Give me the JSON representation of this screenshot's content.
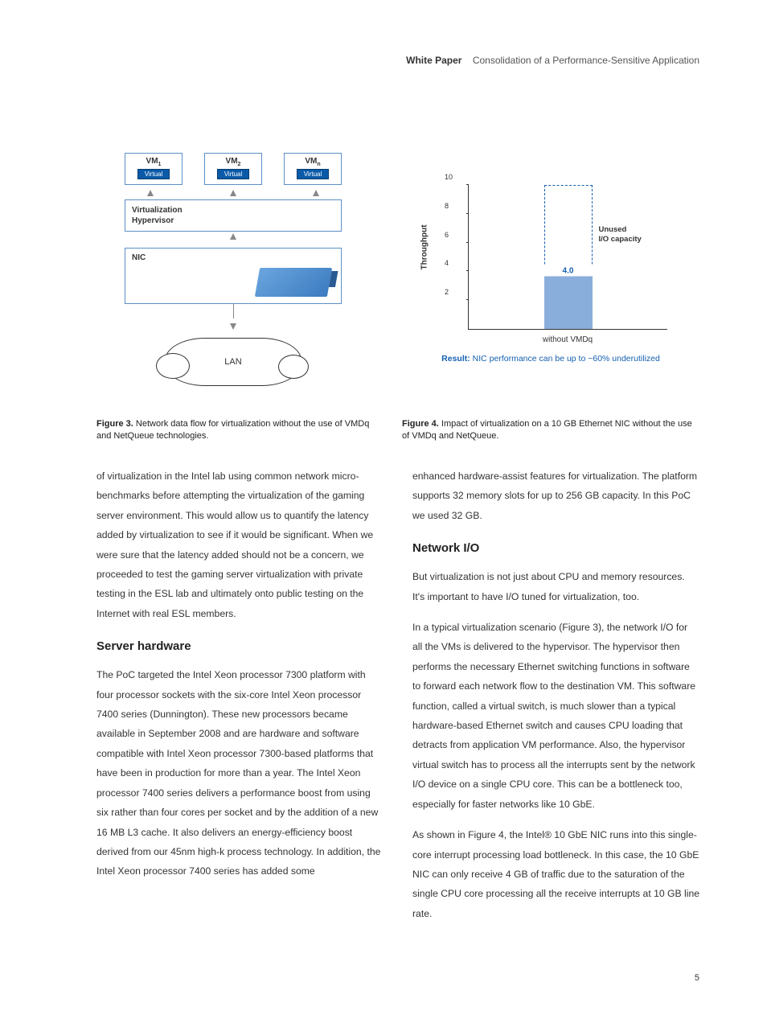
{
  "header": {
    "bold": "White Paper",
    "title": "Consolidation of a Performance-Sensitive Application"
  },
  "figure3": {
    "vm_labels": [
      "VM",
      "VM",
      "VM"
    ],
    "vm_subs": [
      "1",
      "2",
      "n"
    ],
    "virtual_label": "Virtual",
    "hypervisor_line1": "Virtualization",
    "hypervisor_line2": "Hypervisor",
    "nic_label": "NIC",
    "lan_label": "LAN",
    "caption_bold": "Figure 3.",
    "caption_text": " Network data flow for virtualization without the use of VMDq and NetQueue technologies."
  },
  "chart_data": {
    "type": "bar",
    "ylabel": "Throughput",
    "y_ticks": [
      2.0,
      4.0,
      6.0,
      8.0,
      10.0
    ],
    "ylim": [
      0,
      10
    ],
    "categories": [
      "without VMDq"
    ],
    "series": [
      {
        "name": "used",
        "values": [
          4.0
        ]
      },
      {
        "name": "capacity",
        "values": [
          10.0
        ]
      }
    ],
    "bar_value_label": "4.0",
    "unused_label_line1": "Unused",
    "unused_label_line2": "I/O capacity",
    "result_bold": "Result:",
    "result_text": " NIC performance can be up to ~60% underutilized"
  },
  "figure4": {
    "caption_bold": "Figure 4.",
    "caption_text": " Impact of virtualization on a 10 GB Ethernet NIC without the use of VMDq and NetQueue."
  },
  "body": {
    "left_p1": "of virtualization in the Intel lab using common network micro-benchmarks before attempting the virtualization of the gaming server environment. This would allow us to quantify the latency added by virtualization to see if it would be significant. When we were sure that the latency added should not be a concern, we proceeded to test the gaming server virtualization with private testing in the ESL lab and ultimately onto public testing on the Internet with real ESL members.",
    "left_h1": "Server hardware",
    "left_p2": "The PoC targeted the Intel Xeon processor 7300 platform with four processor sockets with the six-core Intel Xeon processor 7400 series (Dunnington). These new processors became available in September 2008 and are hardware and software compatible with Intel Xeon processor 7300-based platforms that have been in production for more than a year. The Intel Xeon processor 7400 series delivers a performance boost from using six rather than four cores per socket and by the addition of a new 16 MB L3 cache. It also delivers an energy-efficiency boost derived from our 45nm high-k process technology. In addition, the Intel Xeon processor 7400 series has added some",
    "right_p1": "enhanced hardware-assist features for virtualization. The platform supports 32 memory slots for up to 256 GB capacity. In this PoC we used 32 GB.",
    "right_h1": "Network I/O",
    "right_p2": "But virtualization is not just about CPU and memory resources. It's important to have I/O tuned for virtualization, too.",
    "right_p3": "In a typical virtualization scenario (Figure 3), the network I/O for all the VMs is delivered to the hypervisor. The hypervisor then performs the necessary Ethernet switching functions in software to forward each network flow to the destination VM. This software function, called a virtual switch, is much slower than a typical hardware-based Ethernet switch and causes CPU loading that detracts from application VM performance. Also, the hypervisor virtual switch has to process all the interrupts sent by the network I/O device on a single CPU core. This can be a bottleneck too, especially for faster networks like 10 GbE.",
    "right_p4": "As shown in Figure 4, the Intel® 10 GbE NIC runs into this single-core interrupt processing load bottleneck. In this case, the 10 GbE NIC can only receive 4 GB of traffic due to the saturation of the single CPU core processing all the receive interrupts at 10 GB line rate."
  },
  "page_number": "5"
}
